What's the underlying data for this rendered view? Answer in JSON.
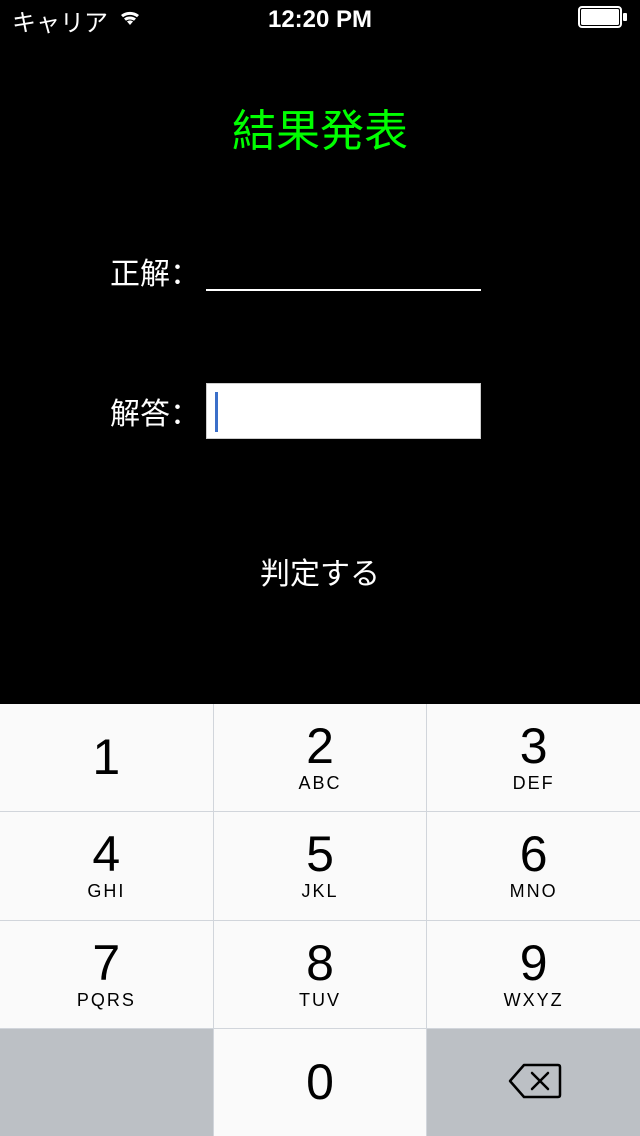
{
  "status_bar": {
    "carrier": "キャリア",
    "time": "12:20 PM"
  },
  "content": {
    "title": "結果発表",
    "correct_label": "正解：",
    "correct_value": "",
    "answer_label": "解答：",
    "answer_value": "",
    "judge_button": "判定する"
  },
  "keypad": {
    "keys": [
      {
        "digit": "1",
        "letters": ""
      },
      {
        "digit": "2",
        "letters": "ABC"
      },
      {
        "digit": "3",
        "letters": "DEF"
      },
      {
        "digit": "4",
        "letters": "GHI"
      },
      {
        "digit": "5",
        "letters": "JKL"
      },
      {
        "digit": "6",
        "letters": "MNO"
      },
      {
        "digit": "7",
        "letters": "PQRS"
      },
      {
        "digit": "8",
        "letters": "TUV"
      },
      {
        "digit": "9",
        "letters": "WXYZ"
      },
      {
        "digit": "0",
        "letters": ""
      }
    ]
  }
}
